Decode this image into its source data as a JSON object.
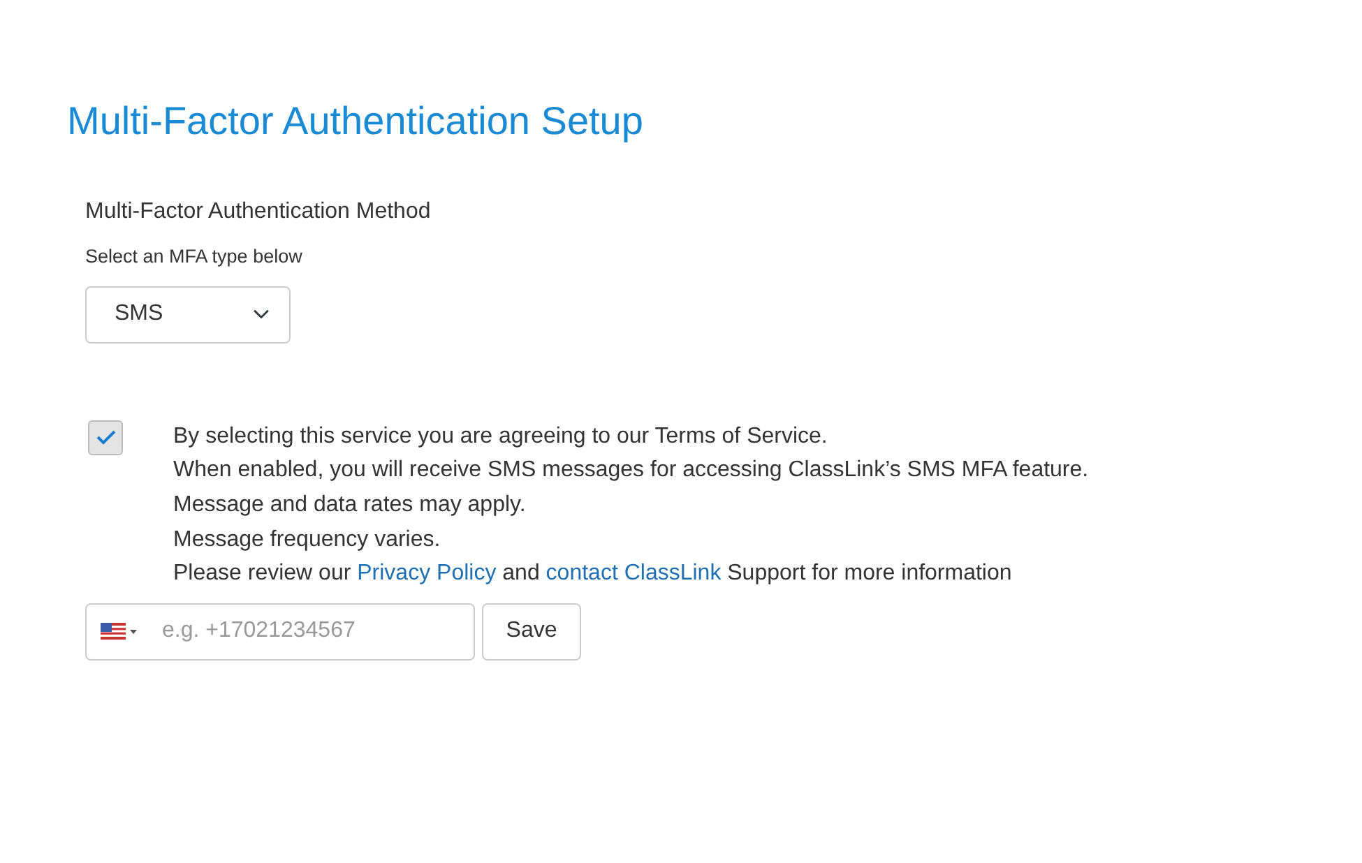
{
  "title": "Multi-Factor Authentication Setup",
  "method": {
    "label": "Multi-Factor Authentication Method",
    "hint": "Select an MFA type below",
    "value": "SMS"
  },
  "consent": {
    "checked": true,
    "lines": [
      [
        {
          "kind": "text",
          "text": "By selecting this service you are agreeing to our Terms of Service."
        }
      ],
      [
        {
          "kind": "text",
          "text": "When enabled, you will receive SMS messages for accessing ClassLink’s SMS MFA feature."
        }
      ],
      [
        {
          "kind": "text",
          "text": "Message and data rates may apply."
        }
      ],
      [
        {
          "kind": "text",
          "text": "Message frequency varies."
        }
      ],
      [
        {
          "kind": "text",
          "text": "Please review our "
        },
        {
          "kind": "link",
          "text": "Privacy Policy"
        },
        {
          "kind": "text",
          "text": " and "
        },
        {
          "kind": "link",
          "text": "contact ClassLink"
        },
        {
          "kind": "text",
          "text": " Support for more information"
        }
      ]
    ]
  },
  "phone": {
    "placeholder": "e.g. +17021234567"
  },
  "save_button": "Save"
}
